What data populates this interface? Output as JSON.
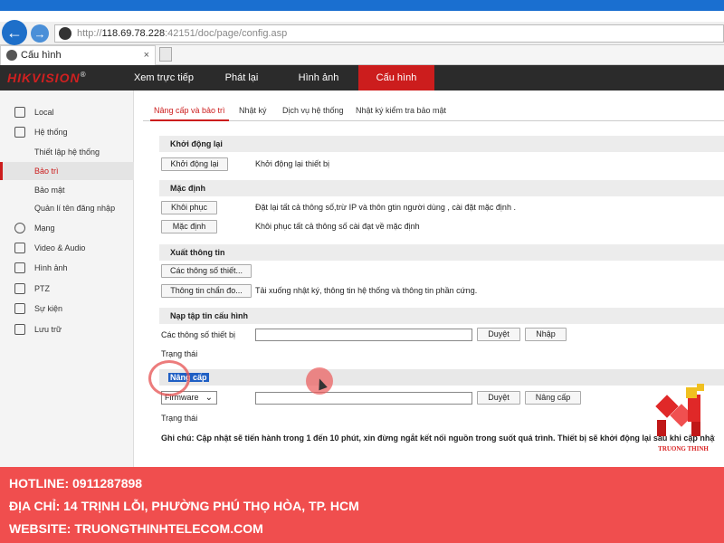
{
  "browser": {
    "url_scheme": "http://",
    "url_host": "118.69.78.228",
    "url_path": ":42151/doc/page/config.asp",
    "tab_title": "Cấu hình",
    "tab_close": "×"
  },
  "header": {
    "logo": "HIKVISION",
    "logo_mark": "®",
    "nav": [
      "Xem trực tiếp",
      "Phát lại",
      "Hình ảnh",
      "Cấu hình"
    ],
    "active_nav": "Cấu hình"
  },
  "sidebar": {
    "items": [
      {
        "label": "Local",
        "icon": "monitor-icon"
      },
      {
        "label": "Hệ thống",
        "icon": "system-icon"
      },
      {
        "label": "Thiết lập hệ thống",
        "icon": ""
      },
      {
        "label": "Bảo trì",
        "icon": ""
      },
      {
        "label": "Bảo mật",
        "icon": ""
      },
      {
        "label": "Quản lí tên đăng nhập",
        "icon": ""
      },
      {
        "label": "Mạng",
        "icon": "globe-icon"
      },
      {
        "label": "Video & Audio",
        "icon": "video-icon"
      },
      {
        "label": "Hình ảnh",
        "icon": "image-icon"
      },
      {
        "label": "PTZ",
        "icon": "ptz-icon"
      },
      {
        "label": "Sự kiện",
        "icon": "calendar-icon"
      },
      {
        "label": "Lưu trữ",
        "icon": "storage-icon"
      }
    ],
    "active": "Bảo trì"
  },
  "subtabs": [
    "Nâng cấp và bảo trì",
    "Nhật ký",
    "Dịch vụ hệ thống",
    "Nhật ký kiểm tra bảo mật"
  ],
  "sections": {
    "reboot": {
      "title": "Khởi động lại",
      "button": "Khởi động lại",
      "desc": "Khởi động lại thiết bị"
    },
    "default": {
      "title": "Mặc định",
      "restore_button": "Khôi phục",
      "restore_desc": "Đặt lại tất cả thông số,trừ IP và thôn gtin người dùng , cài đặt mặc định .",
      "default_button": "Mặc định",
      "default_desc": "Khôi phục tất cả thông số cài đạt về mặc định"
    },
    "export": {
      "title": "Xuất thông tin",
      "params_button": "Các thông số thiết...",
      "diag_button": "Thông tin chẩn đo...",
      "diag_desc": "Tải xuống nhật ký, thông tin hệ thống và thông tin phần cứng."
    },
    "import": {
      "title": "Nạp tập tin cấu hình",
      "label": "Các thông số thiết bị",
      "browse": "Duyệt",
      "import_button": "Nhập",
      "status": "Trạng thái"
    },
    "upgrade": {
      "title": "Nâng cấp",
      "select_value": "Firmware",
      "browse": "Duyệt",
      "upgrade_button": "Nâng cấp",
      "status": "Trạng thái",
      "note": "Ghi chú: Cập nhật sẽ tiến hành trong 1 đến 10 phút, xin đừng ngắt kết nối nguồn trong suốt quá trình. Thiết bị sẽ khởi động lại sau khi cập nhật"
    }
  },
  "watermark": {
    "brand": "TRUONG THINH"
  },
  "footer": {
    "hotline": "HOTLINE: 0911287898",
    "address": "ĐỊA CHỈ: 14 TRỊNH LỖI, PHƯỜNG PHÚ THỌ HÒA, TP. HCM",
    "website": "WEBSITE: TRUONGTHINHTELECOM.COM"
  },
  "colors": {
    "accent": "#cc1d1d",
    "footer": "#f04e4e",
    "header": "#2b2b2b",
    "browser_blue": "#1a6fd0"
  }
}
